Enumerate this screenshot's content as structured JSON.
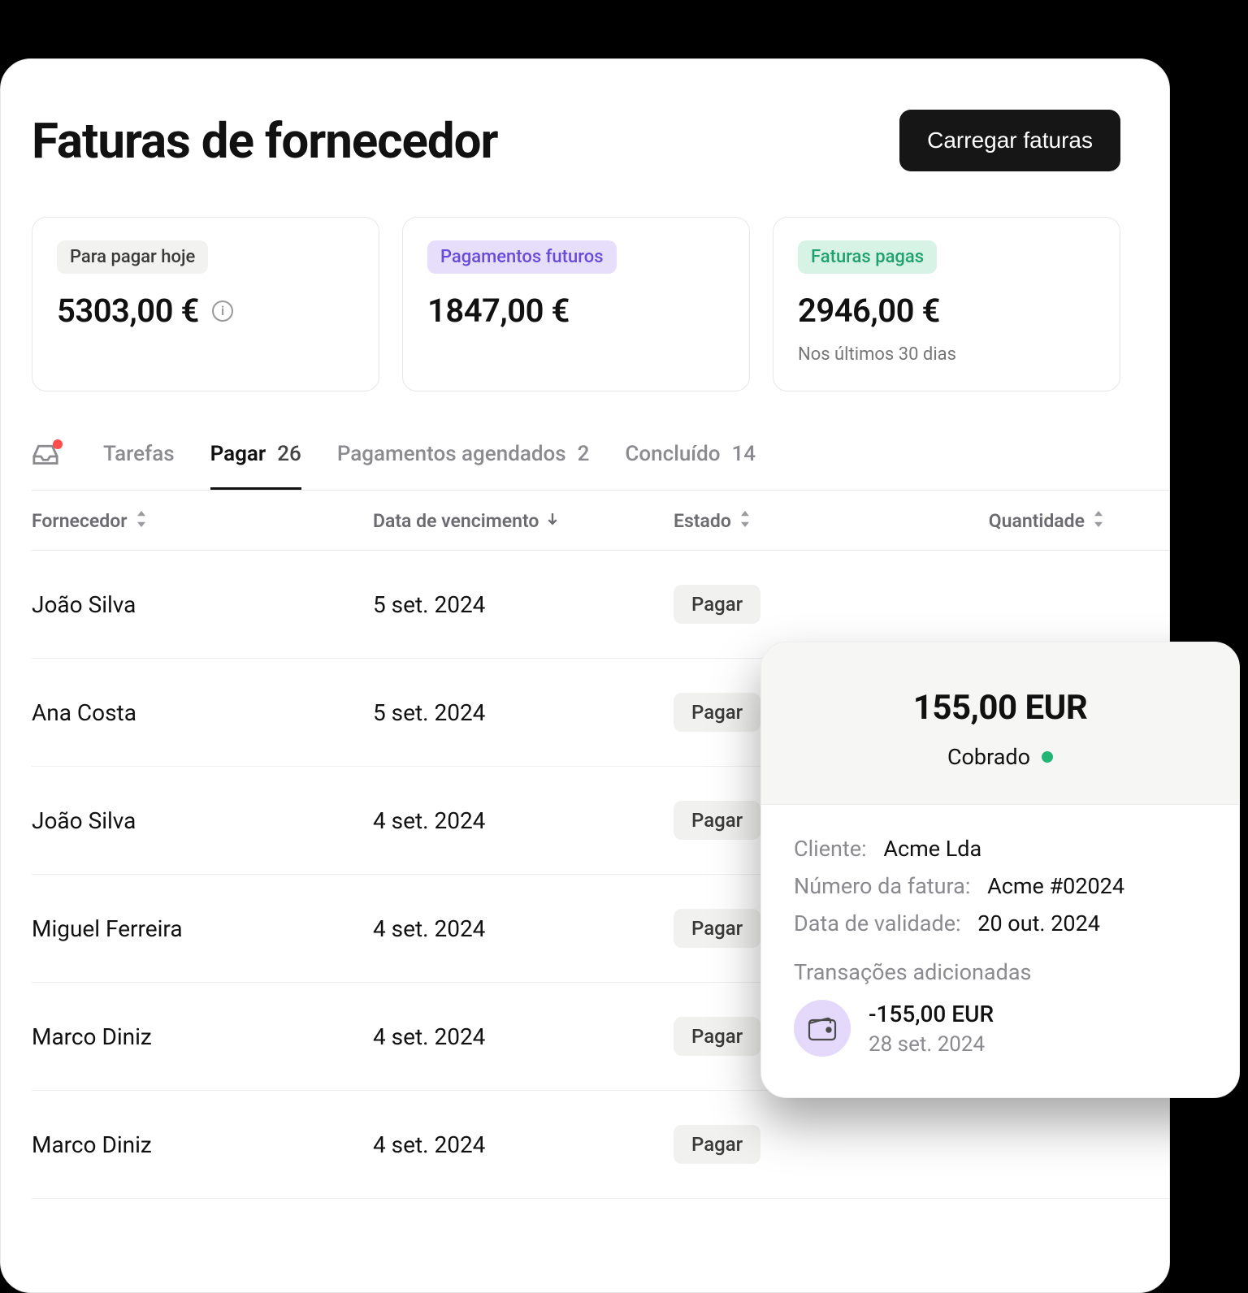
{
  "header": {
    "title": "Faturas de fornecedor",
    "upload_label": "Carregar faturas"
  },
  "cards": {
    "today": {
      "label": "Para pagar hoje",
      "amount": "5303,00 €"
    },
    "future": {
      "label": "Pagamentos futuros",
      "amount": "1847,00 €"
    },
    "paid": {
      "label": "Faturas pagas",
      "amount": "2946,00 €",
      "sub": "Nos últimos 30 dias"
    }
  },
  "tabs": {
    "tasks": "Tarefas",
    "pay": {
      "label": "Pagar",
      "count": "26"
    },
    "scheduled": {
      "label": "Pagamentos agendados",
      "count": "2"
    },
    "done": {
      "label": "Concluído",
      "count": "14"
    }
  },
  "columns": {
    "supplier": "Fornecedor",
    "due": "Data de vencimento",
    "state": "Estado",
    "qty": "Quantidade"
  },
  "state_chip": "Pagar",
  "rows": [
    {
      "supplier": "João Silva",
      "due": "5 set. 2024"
    },
    {
      "supplier": "Ana Costa",
      "due": "5 set. 2024"
    },
    {
      "supplier": "João Silva",
      "due": "4 set. 2024"
    },
    {
      "supplier": "Miguel Ferreira",
      "due": "4 set. 2024"
    },
    {
      "supplier": "Marco Diniz",
      "due": "4 set. 2024"
    },
    {
      "supplier": "Marco Diniz",
      "due": "4 set. 2024"
    }
  ],
  "detail": {
    "amount": "155,00 EUR",
    "status": "Cobrado",
    "client_label": "Cliente:",
    "client_value": "Acme Lda",
    "invoice_label": "Número da fatura:",
    "invoice_value": "Acme #02024",
    "expiry_label": "Data de validade:",
    "expiry_value": "20 out. 2024",
    "tx_title": "Transações adicionadas",
    "tx_amount": "-155,00 EUR",
    "tx_date": "28 set. 2024"
  }
}
